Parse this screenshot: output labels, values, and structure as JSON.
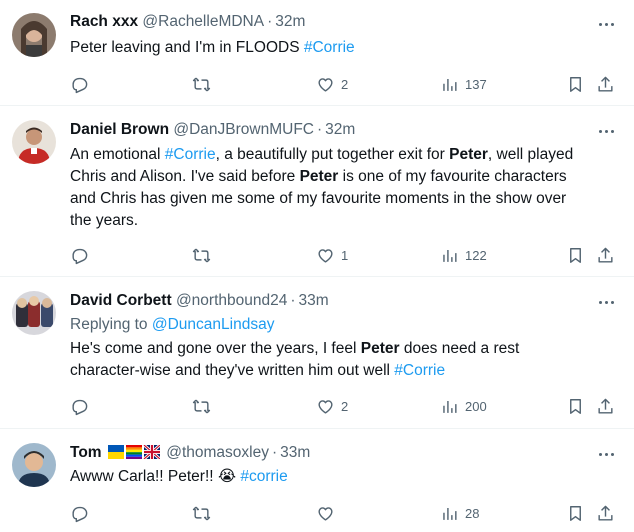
{
  "tweets": [
    {
      "name": "Rach xxx",
      "handle": "@RachelleMDNA",
      "time": "32m",
      "text_parts": [
        "Peter leaving and I'm in FLOODS ",
        "#Corrie"
      ],
      "replies": "",
      "retweets": "",
      "likes": "2",
      "views": "137",
      "avatar_color": "#6b5a4e"
    },
    {
      "name": "Daniel Brown",
      "handle": "@DanJBrownMUFC",
      "time": "32m",
      "line1": [
        "An emotional ",
        "#Corrie",
        ", a beautifully put together exit for ",
        "Peter",
        ", well played"
      ],
      "line2": "Chris and Alison. I've said before ",
      "line2_bold": "Peter",
      "line2_end": " is one of my favourite characters",
      "line3": "and Chris has given me some of my favourite moments in the show over",
      "line4": "the years.",
      "replies": "",
      "retweets": "",
      "likes": "1",
      "views": "122",
      "avatar_color": "#b83a2c"
    },
    {
      "name": "David Corbett",
      "handle": "@northbound24",
      "time": "33m",
      "replying_label": "Replying to ",
      "replying_to": "@DuncanLindsay",
      "line1_start": "He's come and gone over the years, I feel ",
      "line1_bold": "Peter",
      "line1_end": " does need a rest",
      "line2_start": "character-wise and they've written him out well ",
      "line2_tag": "#Corrie",
      "replies": "",
      "retweets": "",
      "likes": "2",
      "views": "200",
      "avatar_color": "#3a3a46"
    },
    {
      "name": "Tom",
      "handle": "@thomasoxley",
      "time": "33m",
      "text_start": "Awww Carla!! ",
      "text_obscured": "Peter!!",
      "text_emoji": "😭",
      "text_tag": "#corrie",
      "replies": "",
      "retweets": "",
      "likes": "",
      "views": "28",
      "avatar_color": "#6b8fb0"
    }
  ],
  "icons": {
    "reply": "reply-icon",
    "retweet": "retweet-icon",
    "like": "heart-icon",
    "views": "views-icon",
    "bookmark": "bookmark-icon",
    "share": "share-icon",
    "more": "more-icon"
  },
  "colors": {
    "link": "#1d9bf0",
    "secondary": "#536471",
    "text": "#0f1419"
  }
}
